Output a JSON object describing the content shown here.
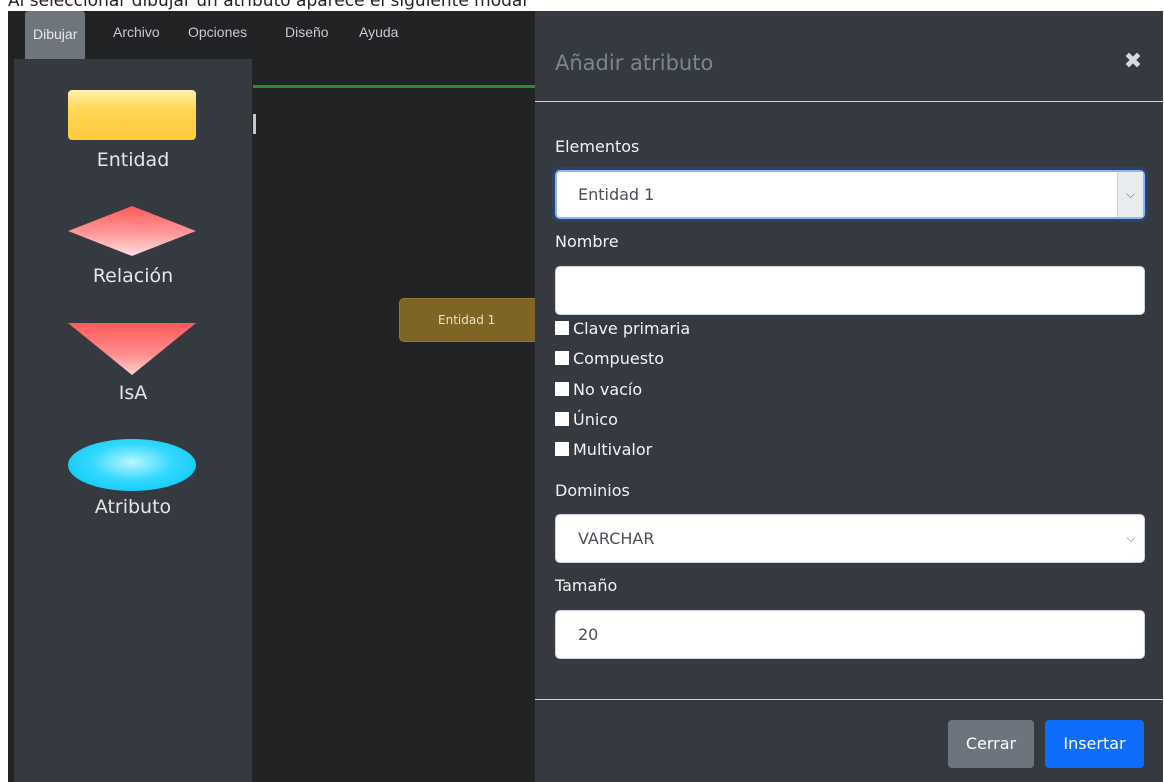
{
  "caption": "Al seleccionar dibujar un atributo aparece el siguiente modal",
  "menu": {
    "items": [
      "Dibujar",
      "Archivo",
      "Opciones",
      "Diseño",
      "Ayuda"
    ]
  },
  "palette": {
    "items": [
      {
        "label": "Entidad",
        "icon": "entity-rectangle-icon",
        "color": "#ffc93a"
      },
      {
        "label": "Relación",
        "icon": "relation-diamond-icon",
        "color": "#ff5f5f"
      },
      {
        "label": "IsA",
        "icon": "isa-triangle-icon",
        "color": "#ff5f5f"
      },
      {
        "label": "Atributo",
        "icon": "attribute-ellipse-icon",
        "color": "#00c2f2"
      }
    ]
  },
  "canvas": {
    "entity_label": "Entidad 1"
  },
  "modal": {
    "title": "Añadir atributo",
    "close_glyph": "✖",
    "elementos": {
      "label": "Elementos",
      "value": "Entidad 1"
    },
    "nombre": {
      "label": "Nombre",
      "value": ""
    },
    "checkboxes": [
      "Clave primaria",
      "Compuesto",
      "No vacío",
      "Único",
      "Multivalor"
    ],
    "dominios": {
      "label": "Dominios",
      "value": "VARCHAR"
    },
    "tamano": {
      "label": "Tamaño",
      "value": "20"
    },
    "buttons": {
      "cerrar": "Cerrar",
      "insertar": "Insertar"
    }
  },
  "colors": {
    "app_bg": "#212325",
    "panel_bg": "#343a40",
    "primary": "#0d6efd",
    "secondary": "#6c757d",
    "accent_line": "#2e8b2e"
  }
}
